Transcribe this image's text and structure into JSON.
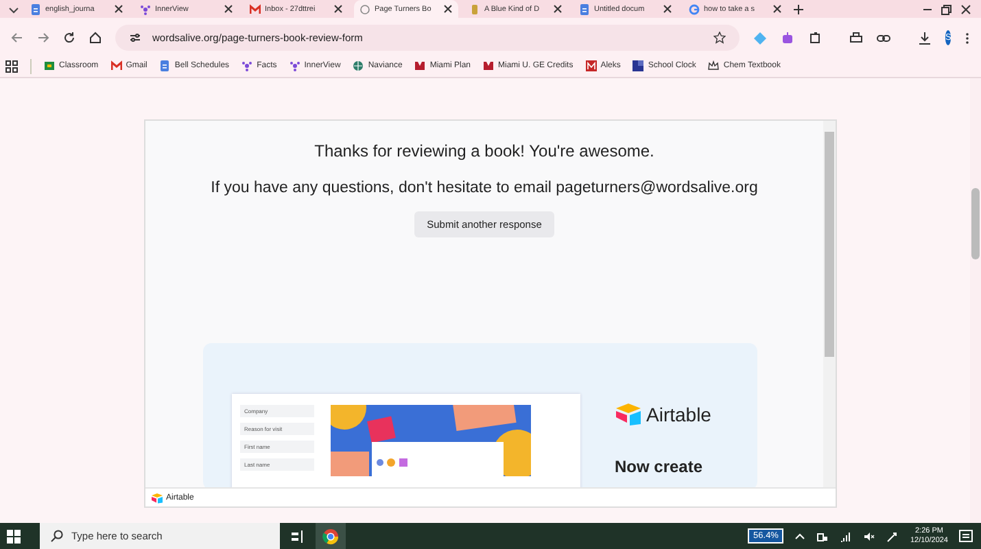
{
  "tabs": [
    {
      "title": "english_journa",
      "kind": "docs",
      "selected": false
    },
    {
      "title": "InnerView",
      "kind": "innerview",
      "selected": false
    },
    {
      "title": "Inbox - 27dttrei",
      "kind": "gmail",
      "selected": false
    },
    {
      "title": "Page Turners Bo",
      "kind": "page",
      "selected": true
    },
    {
      "title": "A Blue Kind of D",
      "kind": "book",
      "selected": false
    },
    {
      "title": "Untitled docum",
      "kind": "docs",
      "selected": false
    },
    {
      "title": "how to take a s",
      "kind": "google",
      "selected": false
    }
  ],
  "address": {
    "url": "wordsalive.org/page-turners-book-review-form"
  },
  "profile": {
    "initial": "S"
  },
  "bookmarks": [
    {
      "label": "Classroom",
      "kind": "classroom"
    },
    {
      "label": "Gmail",
      "kind": "gmail"
    },
    {
      "label": "Bell Schedules",
      "kind": "docs"
    },
    {
      "label": "Facts",
      "kind": "innerview"
    },
    {
      "label": "InnerView",
      "kind": "innerview"
    },
    {
      "label": "Naviance",
      "kind": "globe"
    },
    {
      "label": "Miami Plan",
      "kind": "miami"
    },
    {
      "label": "Miami U. GE Credits",
      "kind": "miami"
    },
    {
      "label": "Aleks",
      "kind": "aleks"
    },
    {
      "label": "School Clock",
      "kind": "clock"
    },
    {
      "label": "Chem Textbook",
      "kind": "crown"
    }
  ],
  "form": {
    "thanks": "Thanks for reviewing a book! You're awesome.",
    "contact": "If you have any questions, don't hesitate to email pageturners@wordsalive.org",
    "button": "Submit another response"
  },
  "promo": {
    "fields": [
      "Company",
      "Reason for visit",
      "First name",
      "Last name"
    ],
    "brand": "Airtable",
    "headline": "Now create"
  },
  "footer": {
    "brand": "Airtable"
  },
  "taskbar": {
    "search_placeholder": "Type here to search",
    "battery": "56.4%",
    "time": "2:26 PM",
    "date": "12/10/2024"
  }
}
